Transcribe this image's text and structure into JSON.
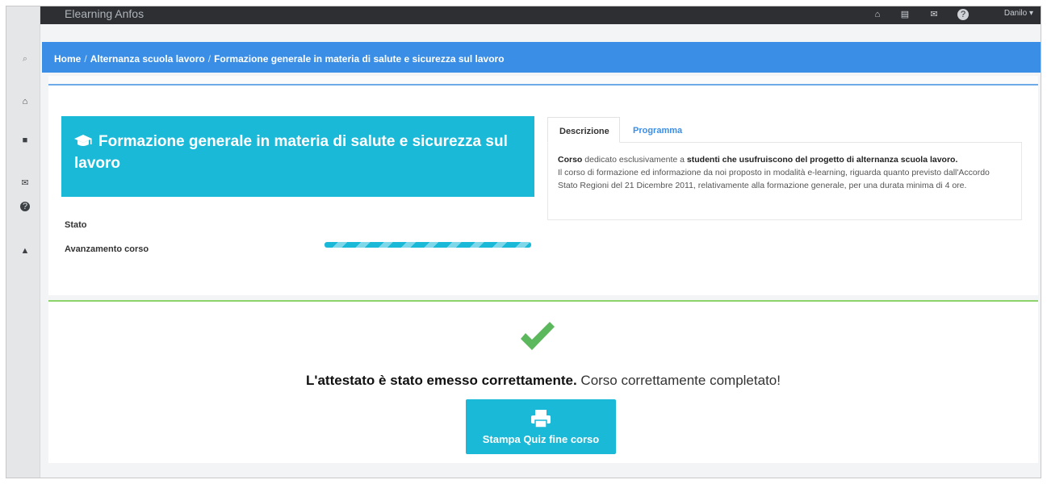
{
  "topbar": {
    "app_title": "Elearning Anfos",
    "user_name": "Danilo ▾",
    "icons": [
      "home-icon",
      "inbox-icon",
      "mail-icon",
      "help-icon"
    ]
  },
  "sidebar": {
    "icons": [
      "search-icon",
      "home-icon",
      "inbox-icon",
      "mail-icon",
      "help-icon",
      "user-icon"
    ]
  },
  "breadcrumb": {
    "items": [
      "Home",
      "Alternanza scuola lavoro",
      "Formazione generale in materia di salute e sicurezza sul lavoro"
    ],
    "separator": "/"
  },
  "course": {
    "title": "Formazione generale in materia di salute e sicurezza sul lavoro",
    "icon": "graduation-cap-icon",
    "status_label": "Stato",
    "progress_label": "Avanzamento corso",
    "progress_percent": 100
  },
  "tabs": {
    "items": [
      "Descrizione",
      "Programma"
    ],
    "active": "Descrizione"
  },
  "description": {
    "part1_bold": "Corso",
    "part2": " dedicato esclusivamente a ",
    "part3_bold": "studenti che usufruiscono del progetto di alternanza scuola lavoro.",
    "body": "Il corso di formazione ed informazione da noi proposto in modalità e-learning, riguarda quanto previsto dall'Accordo Stato Regioni del 21 Dicembre 2011, relativamente alla formazione generale, per una durata minima di 4 ore."
  },
  "completion": {
    "message_bold": "L'attestato è stato emesso correttamente.",
    "message": " Corso correttamente completato!",
    "button_label": "Stampa Quiz fine corso",
    "colors": {
      "success": "#5cb85c",
      "accent": "#1ab9d8",
      "header_blue": "#3a8ee6"
    }
  }
}
